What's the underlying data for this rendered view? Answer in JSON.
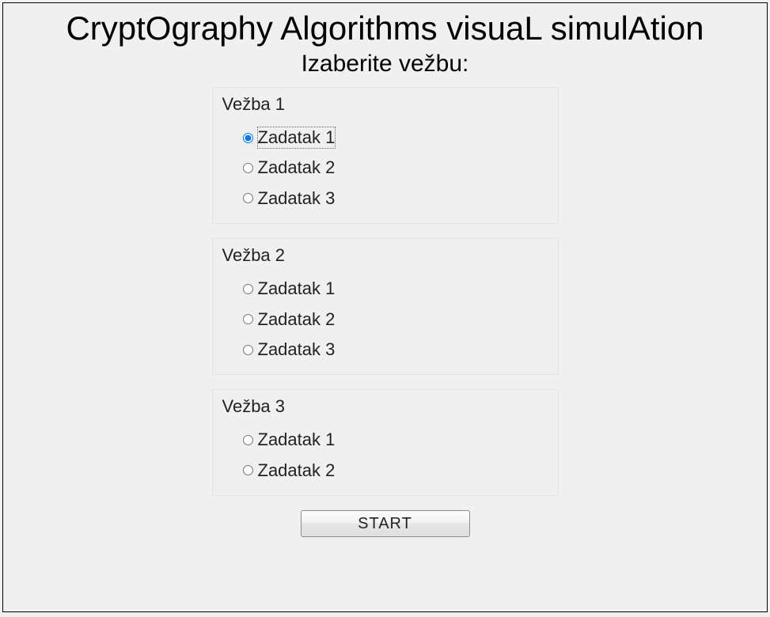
{
  "title": "CryptOgraphy Algorithms visuaL simulAtion",
  "subtitle": "Izaberite vežbu:",
  "groups": [
    {
      "title": "Vežba 1",
      "options": [
        {
          "label": "Zadatak 1",
          "selected": true,
          "focused": true
        },
        {
          "label": "Zadatak 2",
          "selected": false,
          "focused": false
        },
        {
          "label": "Zadatak 3",
          "selected": false,
          "focused": false
        }
      ]
    },
    {
      "title": "Vežba 2",
      "options": [
        {
          "label": "Zadatak 1",
          "selected": false,
          "focused": false
        },
        {
          "label": "Zadatak 2",
          "selected": false,
          "focused": false
        },
        {
          "label": "Zadatak 3",
          "selected": false,
          "focused": false
        }
      ]
    },
    {
      "title": "Vežba 3",
      "options": [
        {
          "label": "Zadatak 1",
          "selected": false,
          "focused": false
        },
        {
          "label": "Zadatak 2",
          "selected": false,
          "focused": false
        }
      ]
    }
  ],
  "start_label": "START"
}
